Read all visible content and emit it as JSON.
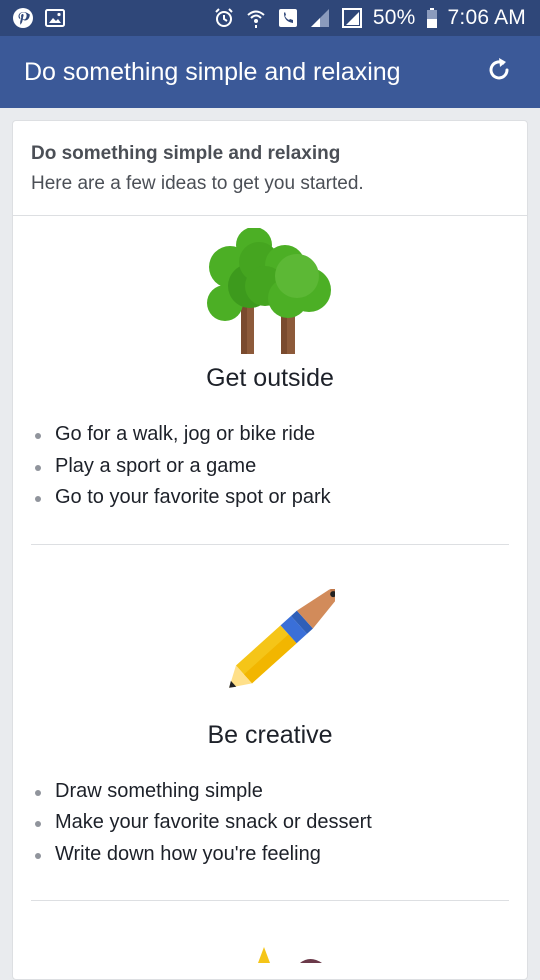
{
  "status_bar": {
    "battery_percent": "50%",
    "time": "7:06 AM",
    "icons": [
      "pinterest-icon",
      "gallery-icon",
      "alarm-icon",
      "wifi-calling-icon",
      "voicemail-icon",
      "signal-icon",
      "no-sim-icon",
      "battery-icon"
    ]
  },
  "app_bar": {
    "title": "Do something simple and relaxing",
    "refresh_icon": "refresh-icon"
  },
  "card": {
    "title": "Do something simple and relaxing",
    "subtitle": "Here are a few ideas to get you started.",
    "sections": [
      {
        "title": "Get outside",
        "icon": "trees-icon",
        "tips": [
          "Go for a walk, jog or bike ride",
          "Play a sport or a game",
          "Go to your favorite spot or park"
        ]
      },
      {
        "title": "Be creative",
        "icon": "pencil-pen-icon",
        "tips": [
          "Draw something simple",
          "Make your favorite snack or dessert",
          "Write down how you're feeling"
        ]
      }
    ]
  },
  "colors": {
    "status_bar": "#2f4779",
    "app_bar": "#3b5998",
    "background": "#e9ebee",
    "tree_green": "#4caf25",
    "pencil_yellow": "#f5c518"
  }
}
